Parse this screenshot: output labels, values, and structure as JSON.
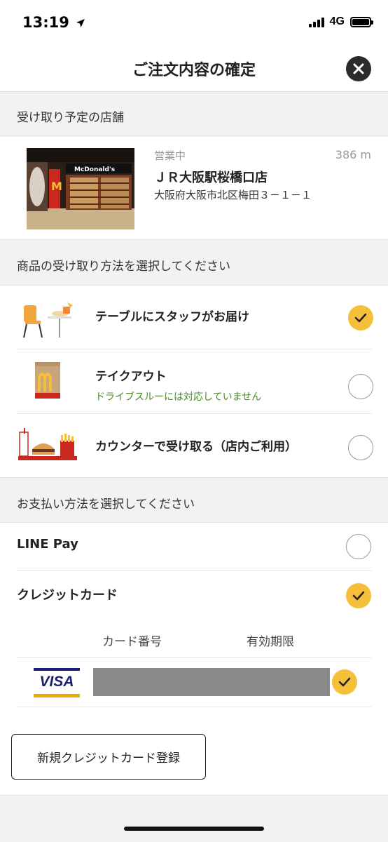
{
  "status_bar": {
    "time": "13:19",
    "network": "4G"
  },
  "header": {
    "title": "ご注文内容の確定"
  },
  "store_section": {
    "heading": "受け取り予定の店舗",
    "status": "営業中",
    "distance": "386 m",
    "name": "ＪＲ大阪駅桜橋口店",
    "address": "大阪府大阪市北区梅田３－１－１",
    "photo_sign": "McDonald's"
  },
  "pickup_section": {
    "heading": "商品の受け取り方法を選択してください",
    "options": [
      {
        "label": "テーブルにスタッフがお届け",
        "note": "",
        "selected": true,
        "icon": "table-delivery-icon"
      },
      {
        "label": "テイクアウト",
        "note": "ドライブスルーには対応していません",
        "selected": false,
        "icon": "takeout-bag-icon"
      },
      {
        "label": "カウンターで受け取る（店内ご利用）",
        "note": "",
        "selected": false,
        "icon": "counter-tray-icon"
      }
    ]
  },
  "payment_section": {
    "heading": "お支払い方法を選択してください",
    "methods": [
      {
        "label": "LINE Pay",
        "selected": false
      },
      {
        "label": "クレジットカード",
        "selected": true
      }
    ],
    "card_table": {
      "col_number": "カード番号",
      "col_expiry": "有効期限",
      "card_brand": "VISA",
      "card_selected": true
    },
    "add_card_label": "新規クレジットカード登録"
  },
  "colors": {
    "accent": "#f5bf3a",
    "note_green": "#4a8a2a",
    "visa_blue": "#1a1f71",
    "visa_gold": "#f2a900"
  }
}
